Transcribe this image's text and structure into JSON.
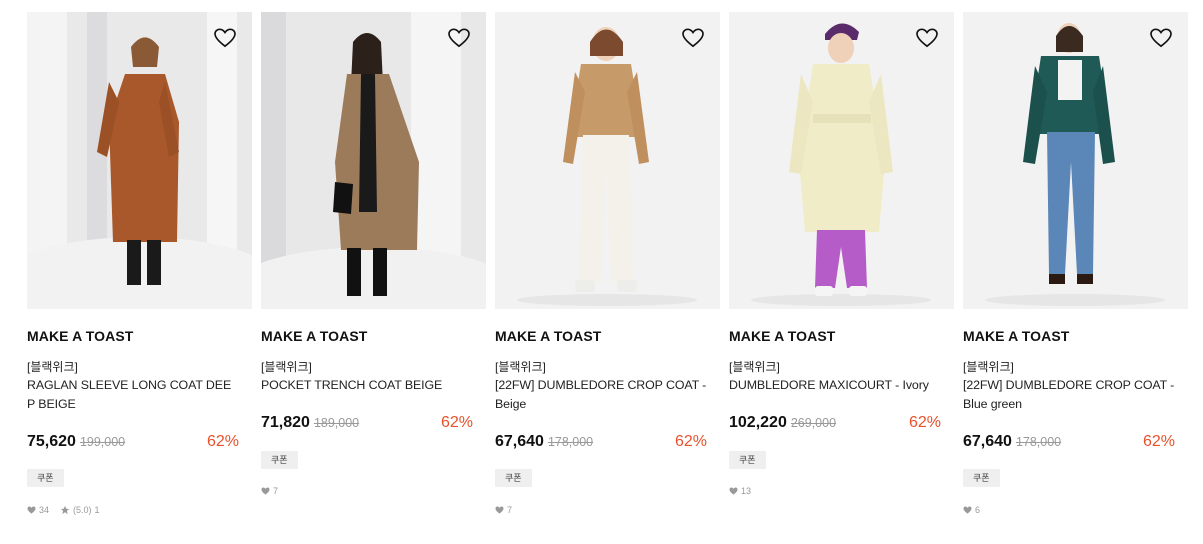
{
  "products": [
    {
      "brand": "MAKE A TOAST",
      "tag": "[블랙위크]",
      "name": "RAGLAN SLEEVE LONG COAT DEEP BEIGE",
      "price": "75,620",
      "original_price": "199,000",
      "discount": "62%",
      "coupon": "쿠폰",
      "likes": "34",
      "rating": "(5.0)",
      "review_count": "1",
      "coat_color": "#a8582b",
      "background": "#eeeeee",
      "wishlist_icon": "heart-outline-icon"
    },
    {
      "brand": "MAKE A TOAST",
      "tag": "[블랙위크]",
      "name": "POCKET TRENCH COAT BEIGE",
      "price": "71,820",
      "original_price": "189,000",
      "discount": "62%",
      "coupon": "쿠폰",
      "likes": "7",
      "coat_color": "#9c7b5b",
      "background": "#ececec",
      "wishlist_icon": "heart-outline-icon"
    },
    {
      "brand": "MAKE A TOAST",
      "tag": "[블랙위크]",
      "name": "[22FW] DUMBLEDORE CROP COAT - Beige",
      "price": "67,640",
      "original_price": "178,000",
      "discount": "62%",
      "coupon": "쿠폰",
      "likes": "7",
      "coat_color": "#c79a6a",
      "background": "#f2f2f2",
      "wishlist_icon": "heart-outline-icon"
    },
    {
      "brand": "MAKE A TOAST",
      "tag": "[블랙위크]",
      "name": "DUMBLEDORE MAXICOURT - Ivory",
      "price": "102,220",
      "original_price": "269,000",
      "discount": "62%",
      "coupon": "쿠폰",
      "likes": "13",
      "coat_color": "#f0ecc8",
      "background": "#f2f2f2",
      "wishlist_icon": "heart-outline-icon"
    },
    {
      "brand": "MAKE A TOAST",
      "tag": "[블랙위크]",
      "name": "[22FW] DUMBLEDORE CROP COAT - Blue green",
      "price": "67,640",
      "original_price": "178,000",
      "discount": "62%",
      "coupon": "쿠폰",
      "likes": "6",
      "coat_color": "#1f5a57",
      "background": "#f2f2f2",
      "wishlist_icon": "heart-outline-icon"
    }
  ],
  "colors": {
    "discount": "#e8512c",
    "original_price": "#999999",
    "coupon_bg": "#efefef"
  }
}
